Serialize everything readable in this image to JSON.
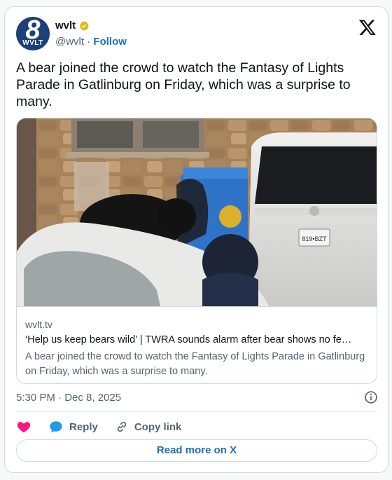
{
  "account": {
    "display_name": "wvlt",
    "handle": "@wvlt",
    "separator": "·",
    "follow_label": "Follow",
    "avatar_number": "8",
    "avatar_callsign": "WVLT",
    "verified_icon": "gold-verified-badge-icon"
  },
  "tweet": {
    "text": "A bear joined the crowd to watch the Fantasy of Lights Parade in Gatlinburg on Friday, which was a surprise to many.",
    "timestamp": "5:30 PM · Dec 8, 2025"
  },
  "link_card": {
    "domain": "wvlt.tv",
    "title": "‘Help us keep bears wild’ | TWRA sounds alarm after bear shows no fe…",
    "description": "A bear joined the crowd to watch the Fantasy of Lights Parade in Gatlinburg on Friday, which was a surprise to many.",
    "license_plate": "819•BZT"
  },
  "actions": {
    "like_icon": "heart-icon",
    "reply_label": "Reply",
    "copy_link_label": "Copy link"
  },
  "read_more_label": "Read more on X",
  "colors": {
    "link_blue": "#1d6fb8",
    "heart_pink": "#f91880",
    "reply_blue": "#1d9bf0",
    "avatar_bg": "#1d3f7a"
  }
}
